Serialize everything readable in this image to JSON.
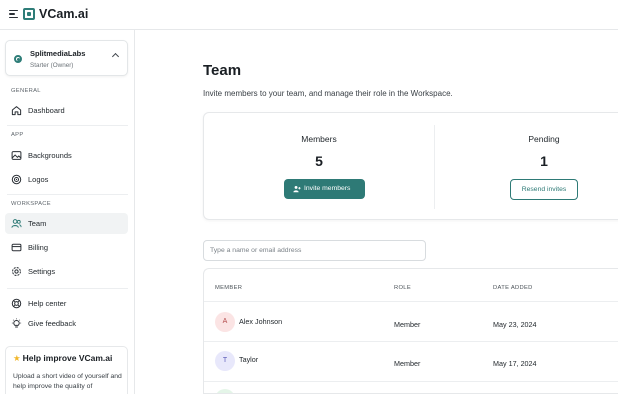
{
  "app": {
    "name": "VCam.ai"
  },
  "workspace": {
    "name": "SplitmediaLabs",
    "plan": "Starter (Owner)"
  },
  "sidebar": {
    "sections": {
      "general": "GENERAL",
      "app": "APP",
      "workspace": "WORKSPACE"
    },
    "items": [
      {
        "label": "Dashboard",
        "icon": "home-icon"
      },
      {
        "label": "Backgrounds",
        "icon": "image-icon"
      },
      {
        "label": "Logos",
        "icon": "target-icon"
      },
      {
        "label": "Team",
        "icon": "users-icon",
        "active": true
      },
      {
        "label": "Billing",
        "icon": "card-icon"
      },
      {
        "label": "Settings",
        "icon": "gear-icon"
      },
      {
        "label": "Help center",
        "icon": "lifebuoy-icon"
      },
      {
        "label": "Give feedback",
        "icon": "lightbulb-icon"
      }
    ],
    "promo": {
      "title": "Help improve VCam.ai",
      "text": "Upload a short video of yourself and help improve the quality of"
    }
  },
  "page": {
    "title": "Team",
    "subtitle": "Invite members to your team, and manage their role in the Workspace."
  },
  "stats": {
    "members": {
      "label": "Members",
      "value": "5",
      "button": "Invite members"
    },
    "pending": {
      "label": "Pending",
      "value": "1",
      "button": "Resend invites"
    }
  },
  "search": {
    "placeholder": "Type a name or email address",
    "value": ""
  },
  "table": {
    "headers": {
      "member": "MEMBER",
      "role": "ROLE",
      "date": "DATE ADDED"
    },
    "rows": [
      {
        "initial": "A",
        "name": "Alex Johnson",
        "role": "Member",
        "date": "May 23, 2024"
      },
      {
        "initial": "T",
        "name": "Taylor",
        "role": "Member",
        "date": "May 17, 2024"
      }
    ]
  },
  "colors": {
    "accent": "#2e7a76",
    "avatar_a": "#fbe4e4",
    "avatar_t": "#e8e8fb"
  }
}
